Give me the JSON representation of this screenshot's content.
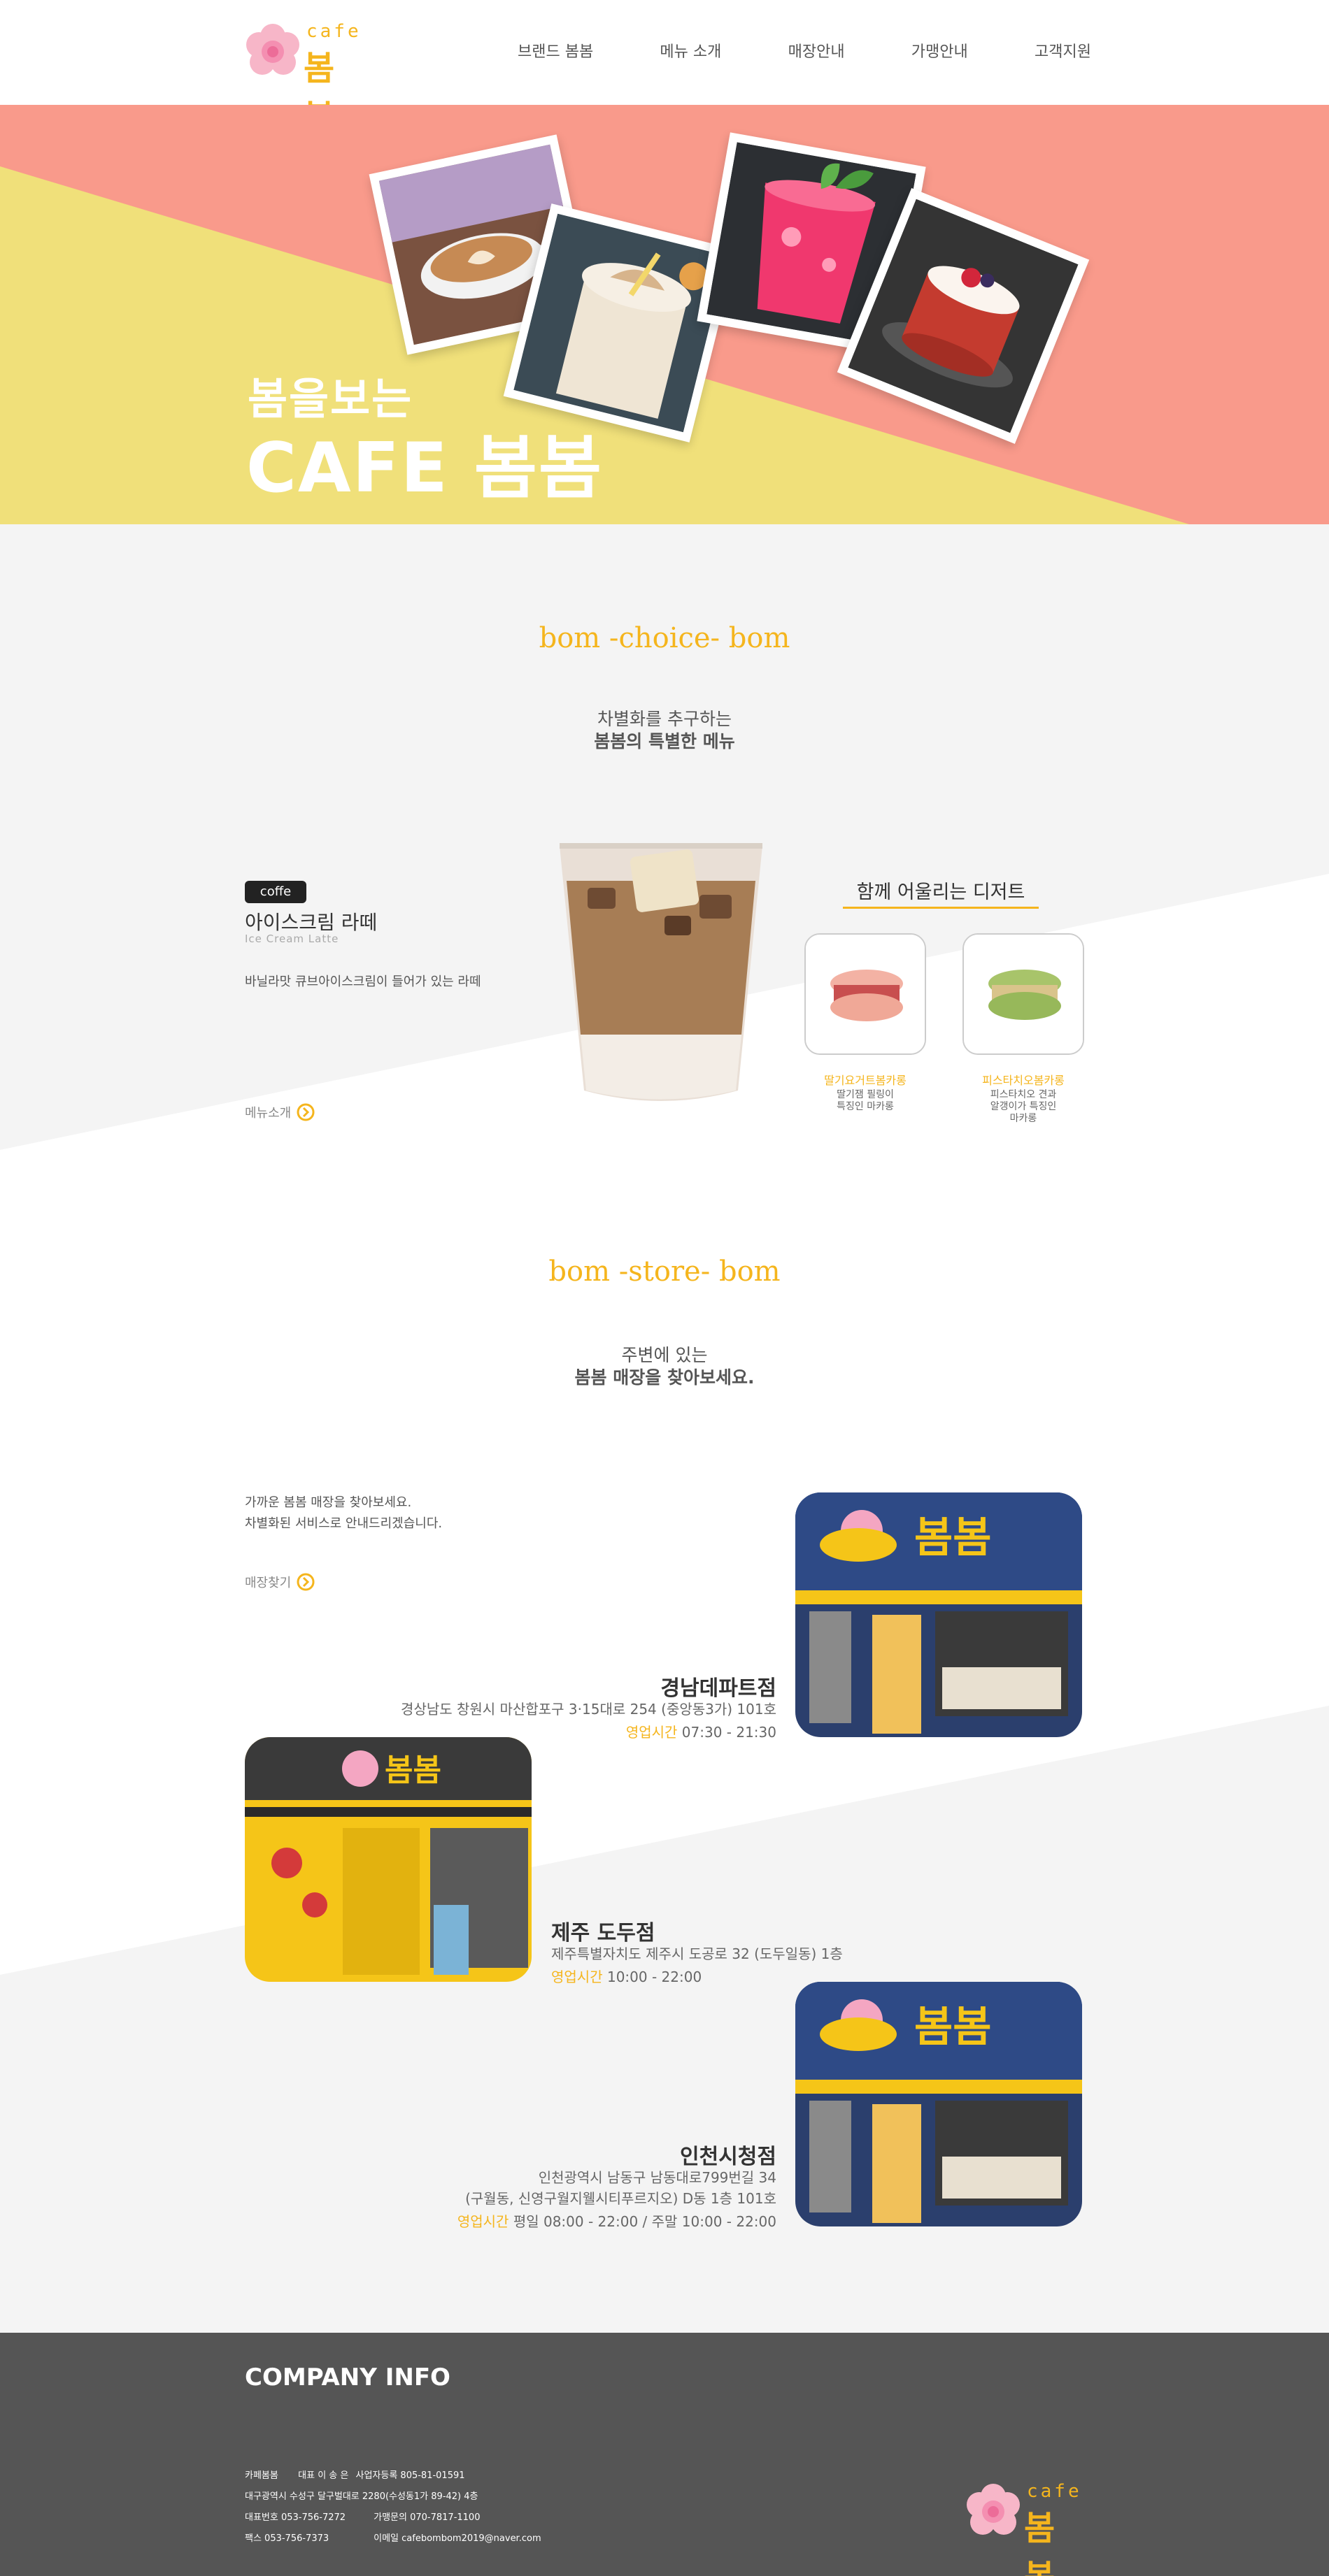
{
  "brand": {
    "cafe_text": "cafe",
    "name_text": "봄봄"
  },
  "nav": {
    "items": [
      "브랜드 봄봄",
      "메뉴 소개",
      "매장안내",
      "가맹안내",
      "고객지원"
    ]
  },
  "hero": {
    "subtitle": "봄을보는",
    "title": "CAFE 봄봄"
  },
  "choice": {
    "title": "bom -choice- bom",
    "desc_line1": "차별화를 추구하는",
    "desc_line2": "봄봄의 특별한 메뉴",
    "badge": "coffe",
    "menu_name": "아이스크림 라떼",
    "menu_eng": "Ice Cream Latte",
    "menu_desc": "바닐라맛 큐브아이스크림이 들어가 있는 라떼",
    "more_label": "메뉴소개",
    "dessert_title": "함께 어울리는 디저트",
    "desserts": [
      {
        "name": "딸기요거트봄카롱",
        "desc1": "딸기잼 필링이",
        "desc2": "특징인 마카롱",
        "desc3": ""
      },
      {
        "name": "피스타치오봄카롱",
        "desc1": "피스타치오 견과",
        "desc2": "알갱이가 특징인",
        "desc3": "마카롱"
      }
    ]
  },
  "store": {
    "title": "bom -store- bom",
    "desc_line1": "주변에 있는",
    "desc_line2": "봄봄 매장을 찾아보세요.",
    "intro_line1": "가까운 봄봄 매장을 찾아보세요.",
    "intro_line2": "차별화된 서비스로 안내드리겠습니다.",
    "more_label": "매장찾기",
    "hours_label": "영업시간",
    "stores": [
      {
        "name": "경남데파트점",
        "addr1": "경상남도 창원시 마산합포구 3·15대로 254 (중앙동3가) 101호",
        "addr2": "",
        "hours": "07:30 - 21:30"
      },
      {
        "name": "제주 도두점",
        "addr1": "제주특별자치도 제주시 도공로 32 (도두일동) 1층",
        "addr2": "",
        "hours": "10:00 - 22:00"
      },
      {
        "name": "인천시청점",
        "addr1": "인천광역시 남동구 남동대로799번길 34",
        "addr2": "(구월동, 신영구월지웰시티푸르지오) D동 1층 101호",
        "hours": "평일 08:00 - 22:00 / 주말 10:00 - 22:00"
      }
    ]
  },
  "footer": {
    "title": "COMPANY INFO",
    "company": "카페봄봄",
    "ceo": "대표 이 송 은",
    "biz_no": "사업자등록 805-81-01591",
    "address": "대구광역시 수성구 달구벌대로 2280(수성동1가 89-42) 4층",
    "phone": "대표번호 053-756-7272",
    "franchise": "가맹문의 070-7817-1100",
    "fax": "팩스 053-756-7373",
    "email": "이메일 cafebombom2019@naver.com"
  },
  "colors": {
    "accent": "#f5b51d",
    "hero_pink": "#f99a8b",
    "hero_yellow": "#f0e07a",
    "footer_bg": "#555555"
  }
}
